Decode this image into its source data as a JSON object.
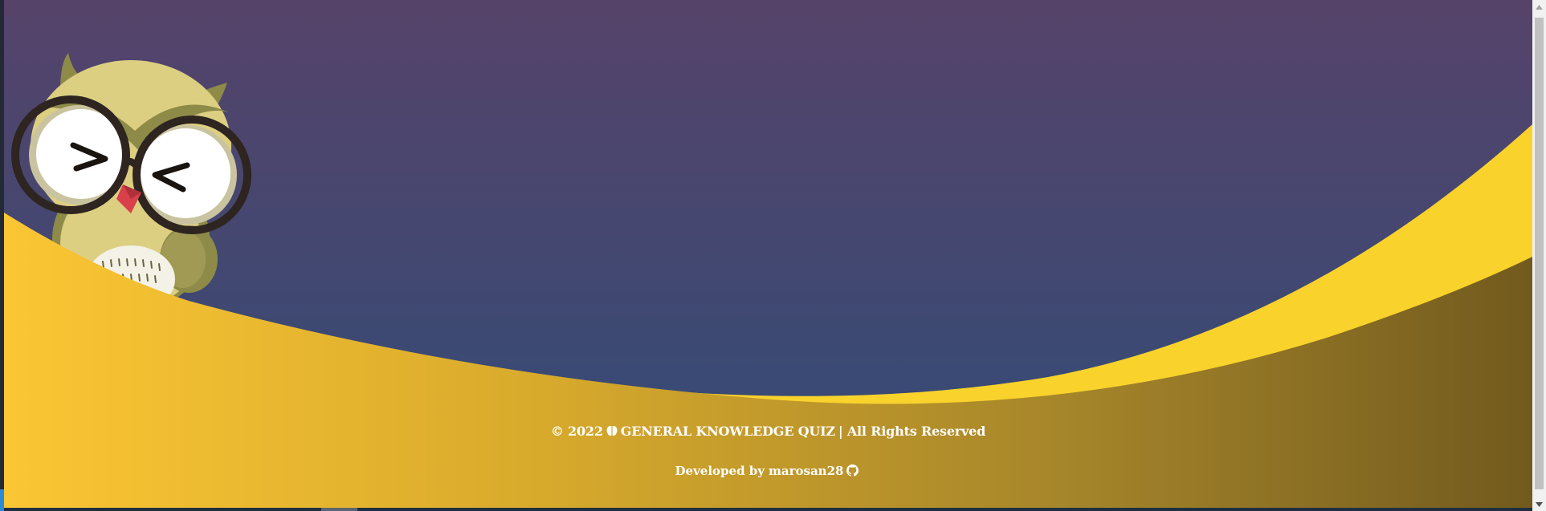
{
  "footer": {
    "copyright_prefix": "© 2022",
    "site_name": "GENERAL KNOWLEDGE QUIZ",
    "rights_text": "| All Rights Reserved",
    "developed_by_label": "Developed by",
    "developer_name": "marosan28"
  },
  "colors": {
    "sky_top": "#56436a",
    "sky_bottom": "#3a4a74",
    "wave_light": "#fbc634",
    "wave_dark": "#7a6020",
    "wave_back": "#f9d22c",
    "owl_body": "#dccf82",
    "owl_feather": "#8e8a48",
    "glasses": "#2e2420",
    "beak": "#d8404a"
  },
  "icons": {
    "brain": "brain-icon",
    "github": "github-icon"
  }
}
